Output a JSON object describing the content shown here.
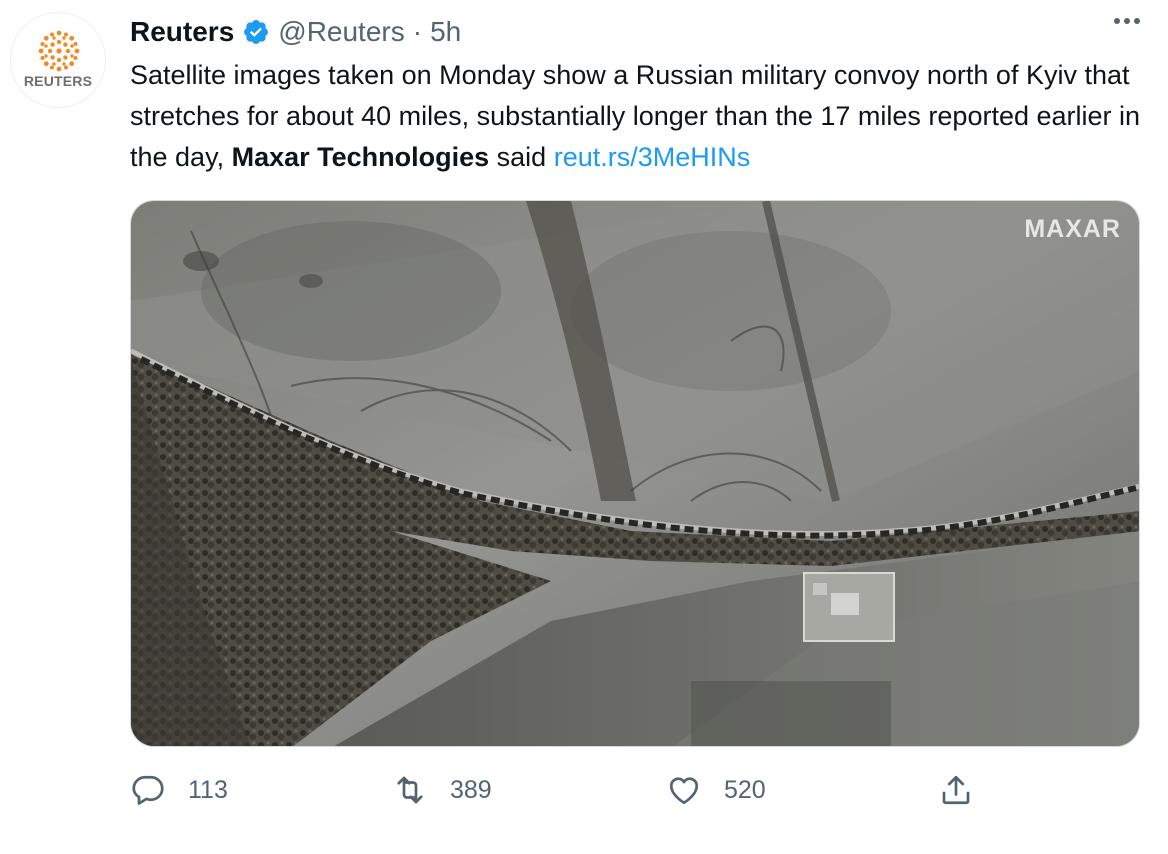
{
  "author": {
    "avatar_label": "REUTERS",
    "display_name": "Reuters",
    "handle": "@Reuters",
    "separator": "·",
    "time": "5h",
    "verified_icon": "verified-badge-icon"
  },
  "tweet": {
    "text_part1": "Satellite images taken on Monday show a Russian military convoy north of Kyiv that stretches for about 40 miles, substantially longer than the 17 miles reported earlier in the day, ",
    "mention_bold": "Maxar Technologies",
    "text_part2": " said ",
    "link_text": "reut.rs/3MeHINs"
  },
  "media": {
    "watermark": "MAXAR"
  },
  "actions": {
    "replies": "113",
    "retweets": "389",
    "likes": "520"
  },
  "colors": {
    "link": "#1d9bf0",
    "secondary_text": "#536471",
    "reuters_orange": "#f08a24"
  }
}
